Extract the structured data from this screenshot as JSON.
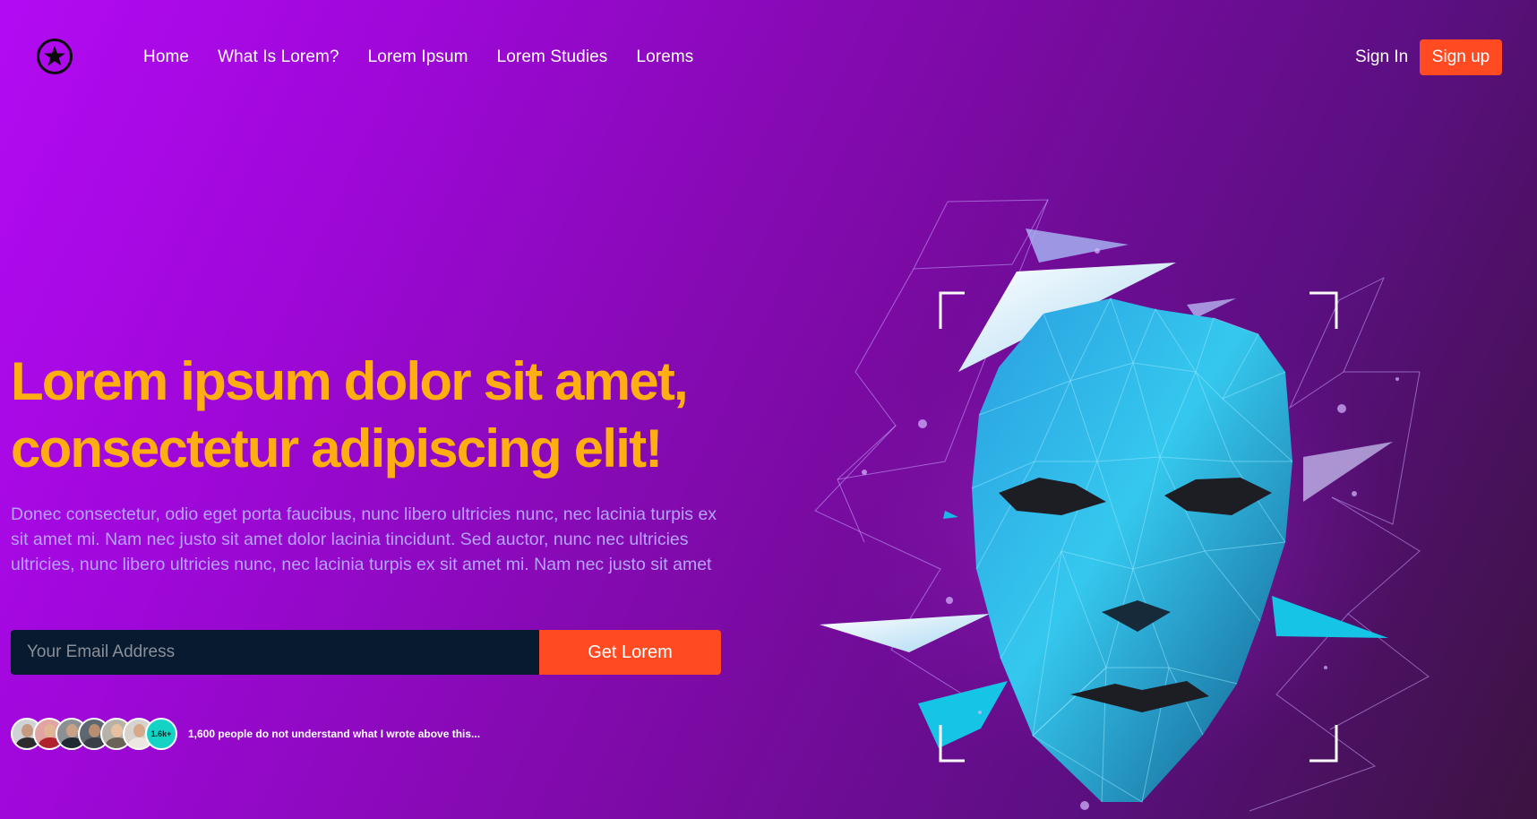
{
  "nav": {
    "logo_icon": "star-circle-icon",
    "links": [
      "Home",
      "What Is Lorem?",
      "Lorem Ipsum",
      "Lorem Studies",
      "Lorems"
    ],
    "sign_in": "Sign In",
    "sign_up": "Sign up"
  },
  "hero": {
    "title_line1": "Lorem ipsum dolor sit amet,",
    "title_line2": "consectetur adipiscing elit!",
    "description": "Donec consectetur, odio eget porta faucibus, nunc libero ultricies nunc, nec lacinia turpis ex sit amet mi. Nam nec justo sit amet dolor lacinia tincidunt. Sed auctor, nunc nec ultricies ultricies, nunc libero ultricies nunc, nec lacinia turpis ex sit amet mi. Nam nec justo sit amet"
  },
  "form": {
    "email_placeholder": "Your Email Address",
    "email_value": "",
    "button": "Get Lorem"
  },
  "social_proof": {
    "count_badge": "1.6k+",
    "text": "1,600 people do not understand what I wrote above this..."
  },
  "illustration": {
    "icon": "low-poly-face-icon"
  },
  "colors": {
    "accent": "#ff4a22",
    "title": "#ffae12",
    "description": "#b6a3ff",
    "input_bg": "#071a30",
    "badge": "#14d3c4"
  }
}
